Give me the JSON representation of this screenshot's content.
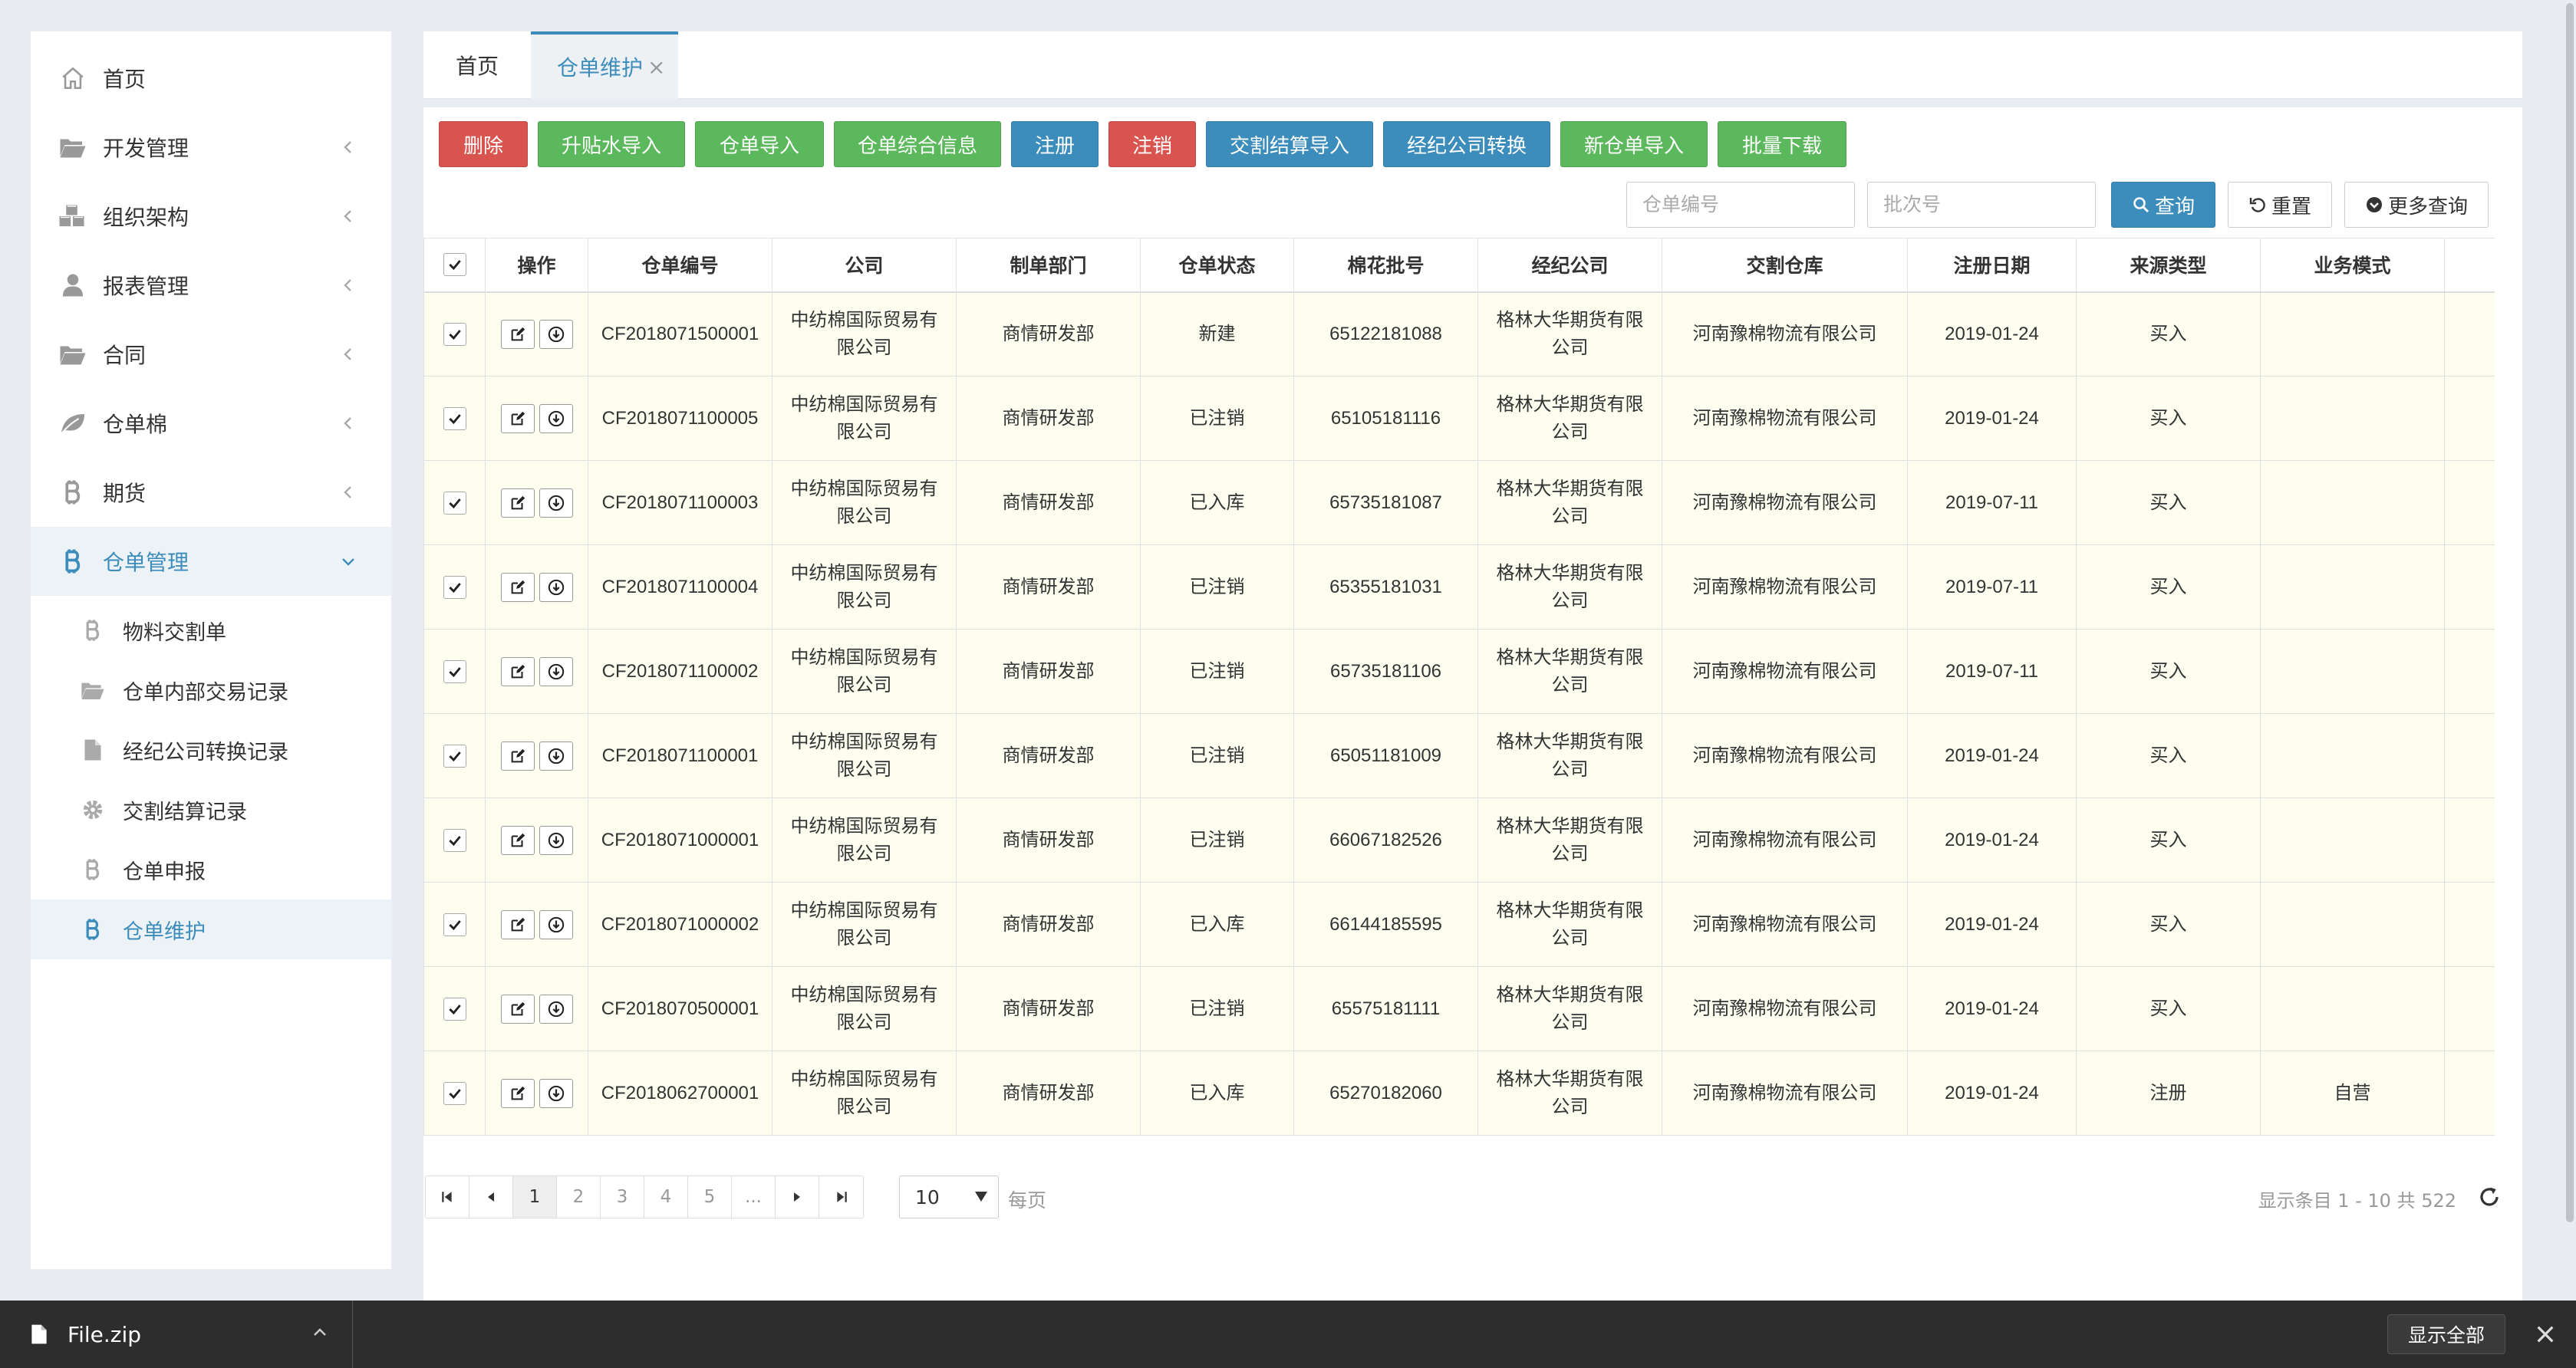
{
  "sidebar": {
    "items": [
      {
        "label": "首页",
        "icon": "home-icon"
      },
      {
        "label": "开发管理",
        "icon": "folder-open-icon"
      },
      {
        "label": "组织架构",
        "icon": "cubes-icon"
      },
      {
        "label": "报表管理",
        "icon": "user-icon"
      },
      {
        "label": "合同",
        "icon": "folder-open-icon"
      },
      {
        "label": "仓单棉",
        "icon": "leaf-icon"
      },
      {
        "label": "期货",
        "icon": "bitcoin-icon"
      },
      {
        "label": "仓单管理",
        "icon": "bitcoin-icon"
      }
    ],
    "sub_items": [
      {
        "label": "物料交割单",
        "icon": "bitcoin-icon"
      },
      {
        "label": "仓单内部交易记录",
        "icon": "folder-open-icon"
      },
      {
        "label": "经纪公司转换记录",
        "icon": "file-icon"
      },
      {
        "label": "交割结算记录",
        "icon": "gear-icon"
      },
      {
        "label": "仓单申报",
        "icon": "bitcoin-icon"
      },
      {
        "label": "仓单维护",
        "icon": "bitcoin-icon"
      }
    ]
  },
  "tabs": {
    "home": "首页",
    "current": "仓单维护",
    "close": "×"
  },
  "toolbar": {
    "buttons": [
      "删除",
      "升贴水导入",
      "仓单导入",
      "仓单综合信息",
      "注册",
      "注销",
      "交割结算导入",
      "经纪公司转换",
      "新仓单导入",
      "批量下载"
    ]
  },
  "search": {
    "receipt_placeholder": "仓单编号",
    "batch_placeholder": "批次号",
    "query_label": "查询",
    "reset_label": "重置",
    "more_label": "更多查询"
  },
  "table": {
    "headers": [
      "操作",
      "仓单编号",
      "公司",
      "制单部门",
      "仓单状态",
      "棉花批号",
      "经纪公司",
      "交割仓库",
      "注册日期",
      "来源类型",
      "业务模式"
    ],
    "rows": [
      {
        "no": "CF2018071500001",
        "company": "中纺棉国际贸易有限公司",
        "dept": "商情研发部",
        "status": "新建",
        "batch": "65122181088",
        "broker": "格林大华期货有限公司",
        "warehouse": "河南豫棉物流有限公司",
        "date": "2019-01-24",
        "source": "买入",
        "mode": ""
      },
      {
        "no": "CF2018071100005",
        "company": "中纺棉国际贸易有限公司",
        "dept": "商情研发部",
        "status": "已注销",
        "batch": "65105181116",
        "broker": "格林大华期货有限公司",
        "warehouse": "河南豫棉物流有限公司",
        "date": "2019-01-24",
        "source": "买入",
        "mode": ""
      },
      {
        "no": "CF2018071100003",
        "company": "中纺棉国际贸易有限公司",
        "dept": "商情研发部",
        "status": "已入库",
        "batch": "65735181087",
        "broker": "格林大华期货有限公司",
        "warehouse": "河南豫棉物流有限公司",
        "date": "2019-07-11",
        "source": "买入",
        "mode": ""
      },
      {
        "no": "CF2018071100004",
        "company": "中纺棉国际贸易有限公司",
        "dept": "商情研发部",
        "status": "已注销",
        "batch": "65355181031",
        "broker": "格林大华期货有限公司",
        "warehouse": "河南豫棉物流有限公司",
        "date": "2019-07-11",
        "source": "买入",
        "mode": ""
      },
      {
        "no": "CF2018071100002",
        "company": "中纺棉国际贸易有限公司",
        "dept": "商情研发部",
        "status": "已注销",
        "batch": "65735181106",
        "broker": "格林大华期货有限公司",
        "warehouse": "河南豫棉物流有限公司",
        "date": "2019-07-11",
        "source": "买入",
        "mode": ""
      },
      {
        "no": "CF2018071100001",
        "company": "中纺棉国际贸易有限公司",
        "dept": "商情研发部",
        "status": "已注销",
        "batch": "65051181009",
        "broker": "格林大华期货有限公司",
        "warehouse": "河南豫棉物流有限公司",
        "date": "2019-01-24",
        "source": "买入",
        "mode": ""
      },
      {
        "no": "CF2018071000001",
        "company": "中纺棉国际贸易有限公司",
        "dept": "商情研发部",
        "status": "已注销",
        "batch": "66067182526",
        "broker": "格林大华期货有限公司",
        "warehouse": "河南豫棉物流有限公司",
        "date": "2019-01-24",
        "source": "买入",
        "mode": ""
      },
      {
        "no": "CF2018071000002",
        "company": "中纺棉国际贸易有限公司",
        "dept": "商情研发部",
        "status": "已入库",
        "batch": "66144185595",
        "broker": "格林大华期货有限公司",
        "warehouse": "河南豫棉物流有限公司",
        "date": "2019-01-24",
        "source": "买入",
        "mode": ""
      },
      {
        "no": "CF2018070500001",
        "company": "中纺棉国际贸易有限公司",
        "dept": "商情研发部",
        "status": "已注销",
        "batch": "65575181111",
        "broker": "格林大华期货有限公司",
        "warehouse": "河南豫棉物流有限公司",
        "date": "2019-01-24",
        "source": "买入",
        "mode": ""
      },
      {
        "no": "CF2018062700001",
        "company": "中纺棉国际贸易有限公司",
        "dept": "商情研发部",
        "status": "已入库",
        "batch": "65270182060",
        "broker": "格林大华期货有限公司",
        "warehouse": "河南豫棉物流有限公司",
        "date": "2019-01-24",
        "source": "注册",
        "mode": "自营"
      }
    ]
  },
  "pagination": {
    "pages": [
      "1",
      "2",
      "3",
      "4",
      "5",
      "..."
    ],
    "current": "1",
    "page_size": "10",
    "per_page_label": "每页",
    "total_text": "显示条目 1 - 10 共 522"
  },
  "download_bar": {
    "file_name": "File.zip",
    "show_all": "显示全部"
  },
  "colors": {
    "accent": "#3c8dbc",
    "danger": "#d9534f",
    "success": "#5cb85c",
    "row_bg": "#fdfdf0"
  }
}
